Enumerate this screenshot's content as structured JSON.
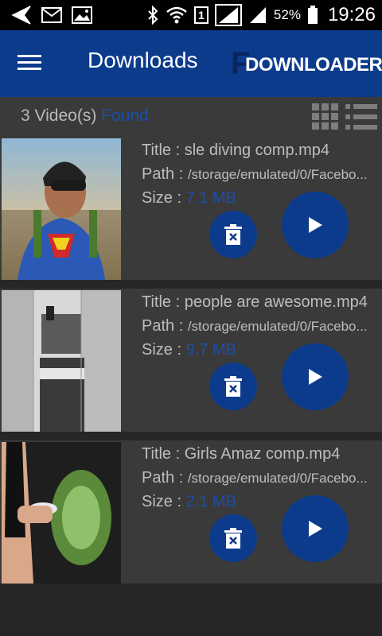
{
  "status_bar": {
    "battery_percent": "52%",
    "time": "19:26",
    "sim_number": "1",
    "icons": [
      "back-arrow-icon",
      "mail-icon",
      "image-icon",
      "bluetooth-icon",
      "wifi-icon",
      "signal-icon",
      "battery-icon"
    ]
  },
  "app_bar": {
    "title": "Downloads",
    "brand_letter": "F",
    "brand_text": "DOWNLOADER",
    "menu_icon": "hamburger-menu-icon"
  },
  "sub_bar": {
    "count_text": "3 Video(s)",
    "found_text": "Found",
    "grid_icon": "grid-view-icon",
    "list_icon": "list-view-icon"
  },
  "labels": {
    "title": "Title : ",
    "path": "Path : ",
    "size": "Size : "
  },
  "videos": [
    {
      "title": "sle diving comp.mp4",
      "path": "/storage/emulated/0/Facebo...",
      "size": "7.1 MB"
    },
    {
      "title": "people are awesome.mp4",
      "path": "/storage/emulated/0/Facebo...",
      "size": "9.7 MB"
    },
    {
      "title": "Girls Amaz comp.mp4",
      "path": "/storage/emulated/0/Facebo...",
      "size": "2.1 MB"
    }
  ],
  "colors": {
    "primary": "#0c3b8c",
    "accent_text": "#1c4ea8",
    "background": "#262626",
    "card": "#3a3a3a"
  }
}
